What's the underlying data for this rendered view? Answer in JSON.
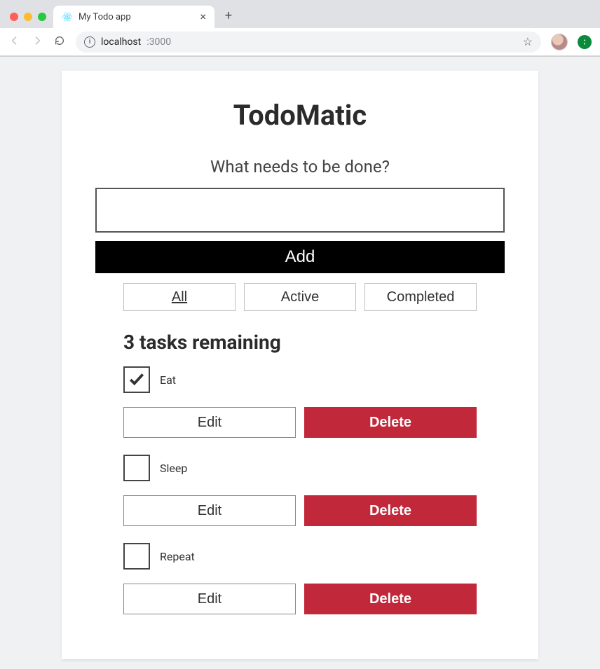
{
  "browser": {
    "tab_title": "My Todo app",
    "url_host": "localhost",
    "url_port": ":3000"
  },
  "app": {
    "title": "TodoMatic",
    "prompt": "What needs to be done?",
    "new_todo_value": "",
    "add_label": "Add",
    "filters": [
      {
        "label": "All",
        "active": true
      },
      {
        "label": "Active",
        "active": false
      },
      {
        "label": "Completed",
        "active": false
      }
    ],
    "tasks_heading": "3 tasks remaining",
    "edit_label": "Edit",
    "delete_label": "Delete",
    "tasks": [
      {
        "label": "Eat",
        "completed": true
      },
      {
        "label": "Sleep",
        "completed": false
      },
      {
        "label": "Repeat",
        "completed": false
      }
    ]
  }
}
